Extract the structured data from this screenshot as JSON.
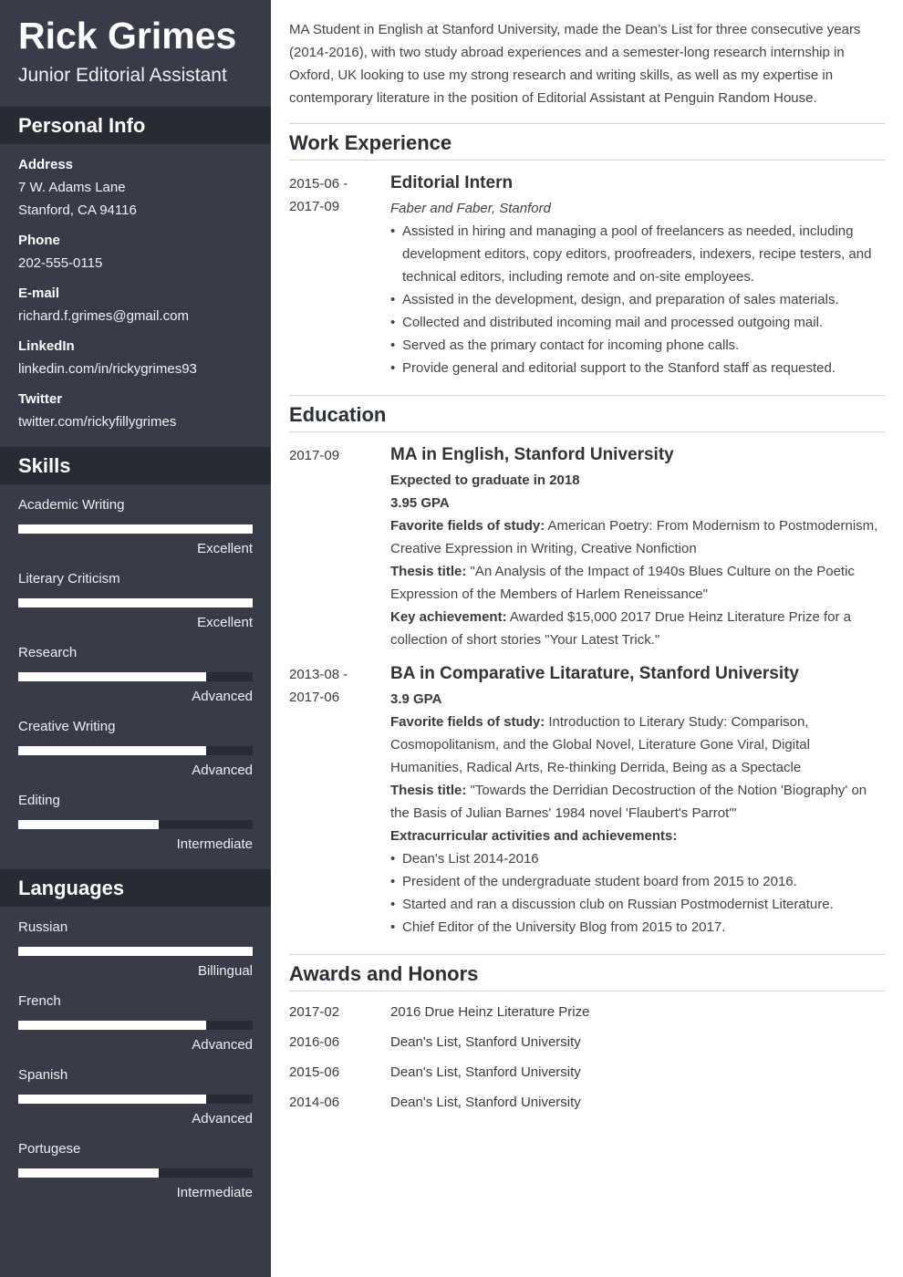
{
  "header": {
    "name": "Rick Grimes",
    "title": "Junior Editorial Assistant"
  },
  "colors": {
    "sidebar_bg": "#373c48",
    "sidebar_header_bg": "#272b33",
    "bar_fill": "#ffffff",
    "bar_track": "#272b33"
  },
  "personal_info": {
    "heading": "Personal Info",
    "address_label": "Address",
    "address_line1": "7 W. Adams Lane",
    "address_line2": "Stanford, CA 94116",
    "phone_label": "Phone",
    "phone": "202-555-0115",
    "email_label": "E-mail",
    "email": "richard.f.grimes@gmail.com",
    "linkedin_label": "LinkedIn",
    "linkedin": "linkedin.com/in/rickygrimes93",
    "twitter_label": "Twitter",
    "twitter": "twitter.com/rickyfillygrimes"
  },
  "skills": {
    "heading": "Skills",
    "items": [
      {
        "name": "Academic Writing",
        "level": "Excellent",
        "fill": 1.0
      },
      {
        "name": "Literary Criticism",
        "level": "Excellent",
        "fill": 1.0
      },
      {
        "name": "Research",
        "level": "Advanced",
        "fill": 0.8
      },
      {
        "name": "Creative Writing",
        "level": "Advanced",
        "fill": 0.8
      },
      {
        "name": "Editing",
        "level": "Intermediate",
        "fill": 0.6
      }
    ]
  },
  "languages": {
    "heading": "Languages",
    "items": [
      {
        "name": "Russian",
        "level": "Billingual",
        "fill": 1.0
      },
      {
        "name": "French",
        "level": "Advanced",
        "fill": 0.8
      },
      {
        "name": "Spanish",
        "level": "Advanced",
        "fill": 0.8
      },
      {
        "name": "Portugese",
        "level": "Intermediate",
        "fill": 0.6
      }
    ]
  },
  "summary": "MA Student in English at Stanford University, made the Dean’s List for three consecutive years (2014-2016), with two study abroad experiences and a semester-long research internship in Oxford, UK looking to use my strong research and writing skills, as well as my expertise in contemporary literature in the position of Editorial Assistant at Penguin Random House.",
  "work": {
    "heading": "Work Experience",
    "items": [
      {
        "date_start": "2015-06 -",
        "date_end": "2017-09",
        "title": "Editorial Intern",
        "company": "Faber and Faber, Stanford",
        "bullets": [
          "Assisted in hiring and managing a pool of freelancers as needed, including development editors, copy editors, proofreaders, indexers, recipe testers, and technical editors, including remote and on-site employees.",
          "Assisted in the development, design, and preparation of sales materials.",
          "Collected and distributed incoming mail and processed outgoing mail.",
          "Served as the primary contact for incoming phone calls.",
          "Provide general and editorial support to the Stanford staff as requested."
        ]
      }
    ]
  },
  "education": {
    "heading": "Education",
    "items": [
      {
        "date_start": "2017-09",
        "title": "MA in English, Stanford University",
        "expected": "Expected to graduate in 2018",
        "gpa": "3.95 GPA",
        "fields_label": "Favorite fields of study:",
        "fields": "American Poetry: From Modernism to Postmodernism, Creative Expression in Writing, Creative Nonfiction",
        "thesis_label": "Thesis title:",
        "thesis": "\"An Analysis of the Impact of 1940s Blues Culture on the Poetic Expression of the Members of Harlem Reneissance\"",
        "achievement_label": "Key achievement:",
        "achievement": "Awarded $15,000 2017 Drue Heinz Literature Prize for a collection of short stories \"Your Latest Trick.\""
      },
      {
        "date_start": "2013-08 -",
        "date_end": "2017-06",
        "title": "BA in Comparative Litarature, Stanford University",
        "gpa": "3.9 GPA",
        "fields_label": "Favorite fields of study:",
        "fields": "Introduction to Literary Study: Comparison, Cosmopolitanism, and the Global Novel, Literature Gone Viral, Digital Humanities, Radical Arts, Re-thinking Derrida, Being as a Spectacle",
        "thesis_label": "Thesis title:",
        "thesis": "\"Towards the Derridian Decostruction of the Notion 'Biography' on the Basis of Julian Barnes' 1984 novel 'Flaubert's Parrot'\"",
        "extra_label": "Extracurricular activities and achievements:",
        "extra": [
          "Dean's List 2014-2016",
          "President of the undergraduate student board from 2015 to 2016.",
          "Started and ran a discussion club on Russian Postmodernist Literature.",
          "Chief Editor of the University Blog from 2015 to 2017."
        ]
      }
    ]
  },
  "awards": {
    "heading": "Awards and Honors",
    "items": [
      {
        "date": "2017-02",
        "name": "2016 Drue Heinz Literature Prize"
      },
      {
        "date": "2016-06",
        "name": "Dean's List, Stanford University"
      },
      {
        "date": "2015-06",
        "name": "Dean's List, Stanford University"
      },
      {
        "date": "2014-06",
        "name": "Dean's List, Stanford University"
      }
    ]
  }
}
